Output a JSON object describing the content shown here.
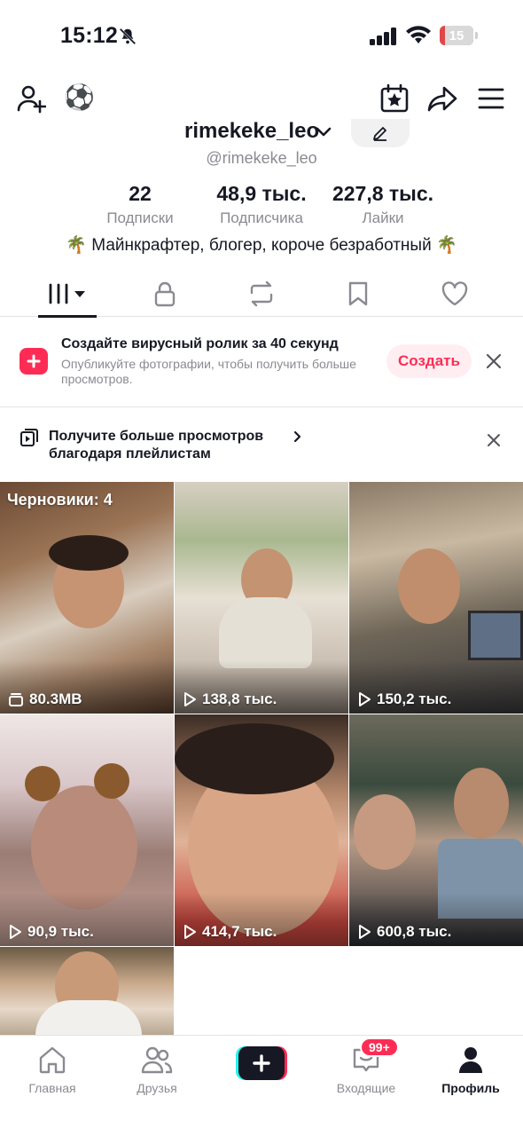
{
  "status_bar": {
    "time": "15:12",
    "battery_level": "15",
    "battery_color": "#e04848"
  },
  "top_nav": {
    "add_friend_icon": "add-person-icon",
    "ball_emoji": "⚽",
    "icons": [
      "calendar-star-icon",
      "share-arrow-icon",
      "menu-icon"
    ]
  },
  "profile": {
    "username": "rimekeke_leo",
    "handle": "@rimekeke_leo",
    "stats": [
      {
        "value": "22",
        "label": "Подписки"
      },
      {
        "value": "48,9 тыс.",
        "label": "Подписчика"
      },
      {
        "value": "227,8 тыс.",
        "label": "Лайки"
      }
    ],
    "bio": "🌴 Майнкрафтер, блогер, короче безработный 🌴"
  },
  "tabs": [
    "videos-grid-icon",
    "lock-icon",
    "repost-icon",
    "bookmark-icon",
    "heart-icon"
  ],
  "banner_create": {
    "title": "Создайте вирусный ролик за 40 секунд",
    "subtitle": "Опубликуйте фотографии, чтобы получить больше просмотров.",
    "button": "Создать"
  },
  "banner_playlist": {
    "line1": "Получите больше просмотров",
    "line2": "благодаря плейлистам"
  },
  "videos": [
    {
      "overlay": "Черновики: 4",
      "count": "80.3MB",
      "kind": "drafts"
    },
    {
      "count": "138,8 тыс."
    },
    {
      "count": "150,2 тыс."
    },
    {
      "count": "90,9 тыс."
    },
    {
      "count": "414,7 тыс."
    },
    {
      "count": "600,8 тыс."
    },
    {
      "count": ""
    }
  ],
  "bottom_nav": {
    "items": [
      {
        "label": "Главная",
        "icon": "home-icon"
      },
      {
        "label": "Друзья",
        "icon": "friends-icon"
      },
      {
        "label": "",
        "icon": "plus-icon"
      },
      {
        "label": "Входящие",
        "icon": "inbox-icon"
      },
      {
        "label": "Профиль",
        "icon": "profile-icon"
      }
    ],
    "inbox_badge": "99+"
  },
  "colors": {
    "accent": "#fe2c55",
    "text": "#161823",
    "muted": "#8a8b91"
  }
}
